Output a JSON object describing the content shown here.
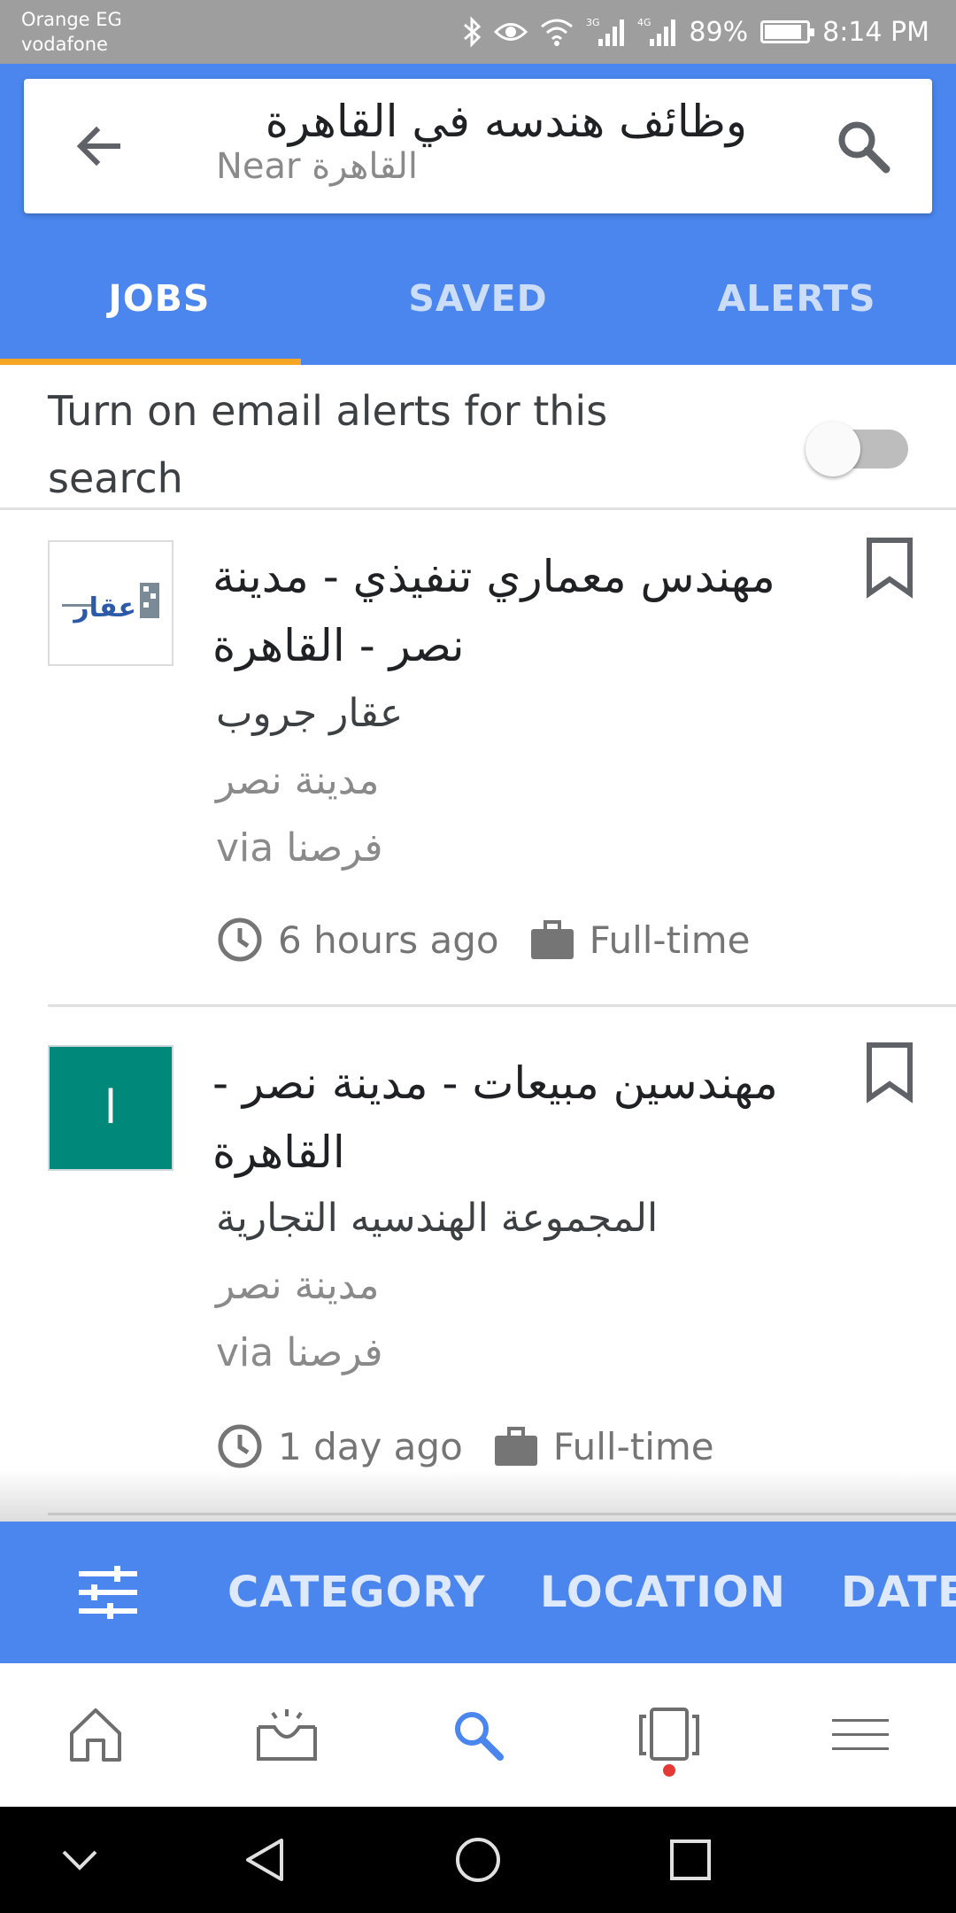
{
  "status_bar": {
    "carrier_line1": "Orange EG",
    "carrier_line2": "vodafone",
    "network1": "3G",
    "network2": "4G",
    "battery_text": "89%",
    "battery_level": 0.89,
    "time": "8:14 PM"
  },
  "search": {
    "query": "وظائف هندسه في القاهرة",
    "near": "Near القاهرة"
  },
  "tabs": [
    {
      "label": "JOBS",
      "active": true
    },
    {
      "label": "SAVED",
      "active": false
    },
    {
      "label": "ALERTS",
      "active": false
    }
  ],
  "email_alerts": {
    "text": "Turn on email alerts for this search",
    "enabled": false
  },
  "jobs": [
    {
      "title": "مهندس معماري تنفيذي - مدينة نصر - القاهرة",
      "company": "عقار جروب",
      "location": "مدينة نصر",
      "source": "via فرصنا",
      "logo_text": "عقار",
      "posted": "6 hours ago",
      "type": "Full-time"
    },
    {
      "title": "مهندسين مبيعات - مدينة نصر - القاهرة",
      "company": "المجموعة الهندسيه التجارية",
      "location": "مدينة نصر",
      "source": "via فرصنا",
      "logo_text": "ا",
      "logo_color": "#00897b",
      "posted": "1 day ago",
      "type": "Full-time"
    }
  ],
  "filters": {
    "items": [
      "CATEGORY",
      "LOCATION",
      "DATE"
    ]
  },
  "colors": {
    "primary": "#4a86ee",
    "tab_indicator": "#f5a623",
    "nav_active": "#4a86ee",
    "notification_dot": "#e53935"
  }
}
